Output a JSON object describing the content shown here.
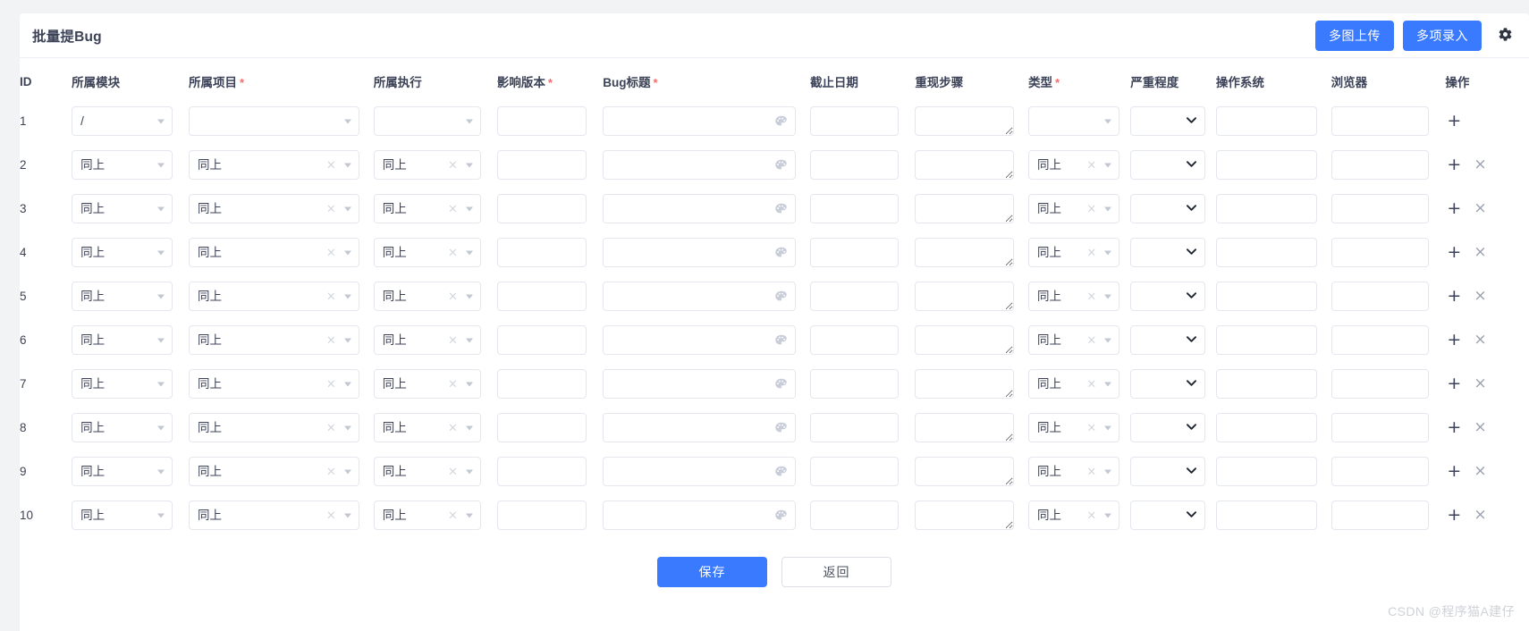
{
  "header": {
    "title": "批量提Bug",
    "buttons": [
      {
        "label": "多图上传",
        "name": "multi-image-upload-button"
      },
      {
        "label": "多项录入",
        "name": "multi-entry-button"
      }
    ],
    "gear_icon": "gear-icon",
    "primary_color": "#3a7afe"
  },
  "columns": [
    {
      "key": "id",
      "label": "ID",
      "required": false
    },
    {
      "key": "module",
      "label": "所属模块",
      "required": false
    },
    {
      "key": "project",
      "label": "所属项目",
      "required": true
    },
    {
      "key": "exec",
      "label": "所属执行",
      "required": false
    },
    {
      "key": "version",
      "label": "影响版本",
      "required": true
    },
    {
      "key": "title",
      "label": "Bug标题",
      "required": true
    },
    {
      "key": "due",
      "label": "截止日期",
      "required": false
    },
    {
      "key": "steps",
      "label": "重现步骤",
      "required": false
    },
    {
      "key": "type",
      "label": "类型",
      "required": true
    },
    {
      "key": "severity",
      "label": "严重程度",
      "required": false
    },
    {
      "key": "os",
      "label": "操作系统",
      "required": false
    },
    {
      "key": "browser",
      "label": "浏览器",
      "required": false
    },
    {
      "key": "action",
      "label": "操作",
      "required": false
    }
  ],
  "same_as_above_label": "同上",
  "first_row_module_value": "/",
  "empty_value": "",
  "icons": {
    "palette": "palette-icon",
    "clear": "×",
    "add": "+",
    "remove": "×",
    "chevron_down": "❯"
  },
  "rows": [
    {
      "id": "1",
      "module": "/",
      "project": "",
      "exec": "",
      "version": "",
      "title": "",
      "due": "",
      "steps": "",
      "type": "",
      "severity": "",
      "os": "",
      "browser": "",
      "clearable": false,
      "removable": false
    },
    {
      "id": "2",
      "module": "同上",
      "project": "同上",
      "exec": "同上",
      "version": "",
      "title": "",
      "due": "",
      "steps": "",
      "type": "同上",
      "severity": "",
      "os": "",
      "browser": "",
      "clearable": true,
      "removable": true
    },
    {
      "id": "3",
      "module": "同上",
      "project": "同上",
      "exec": "同上",
      "version": "",
      "title": "",
      "due": "",
      "steps": "",
      "type": "同上",
      "severity": "",
      "os": "",
      "browser": "",
      "clearable": true,
      "removable": true
    },
    {
      "id": "4",
      "module": "同上",
      "project": "同上",
      "exec": "同上",
      "version": "",
      "title": "",
      "due": "",
      "steps": "",
      "type": "同上",
      "severity": "",
      "os": "",
      "browser": "",
      "clearable": true,
      "removable": true
    },
    {
      "id": "5",
      "module": "同上",
      "project": "同上",
      "exec": "同上",
      "version": "",
      "title": "",
      "due": "",
      "steps": "",
      "type": "同上",
      "severity": "",
      "os": "",
      "browser": "",
      "clearable": true,
      "removable": true
    },
    {
      "id": "6",
      "module": "同上",
      "project": "同上",
      "exec": "同上",
      "version": "",
      "title": "",
      "due": "",
      "steps": "",
      "type": "同上",
      "severity": "",
      "os": "",
      "browser": "",
      "clearable": true,
      "removable": true
    },
    {
      "id": "7",
      "module": "同上",
      "project": "同上",
      "exec": "同上",
      "version": "",
      "title": "",
      "due": "",
      "steps": "",
      "type": "同上",
      "severity": "",
      "os": "",
      "browser": "",
      "clearable": true,
      "removable": true
    },
    {
      "id": "8",
      "module": "同上",
      "project": "同上",
      "exec": "同上",
      "version": "",
      "title": "",
      "due": "",
      "steps": "",
      "type": "同上",
      "severity": "",
      "os": "",
      "browser": "",
      "clearable": true,
      "removable": true
    },
    {
      "id": "9",
      "module": "同上",
      "project": "同上",
      "exec": "同上",
      "version": "",
      "title": "",
      "due": "",
      "steps": "",
      "type": "同上",
      "severity": "",
      "os": "",
      "browser": "",
      "clearable": true,
      "removable": true
    },
    {
      "id": "10",
      "module": "同上",
      "project": "同上",
      "exec": "同上",
      "version": "",
      "title": "",
      "due": "",
      "steps": "",
      "type": "同上",
      "severity": "",
      "os": "",
      "browser": "",
      "clearable": true,
      "removable": true
    }
  ],
  "footer": {
    "save_label": "保存",
    "back_label": "返回"
  },
  "watermark": "CSDN @程序猫A建仔"
}
